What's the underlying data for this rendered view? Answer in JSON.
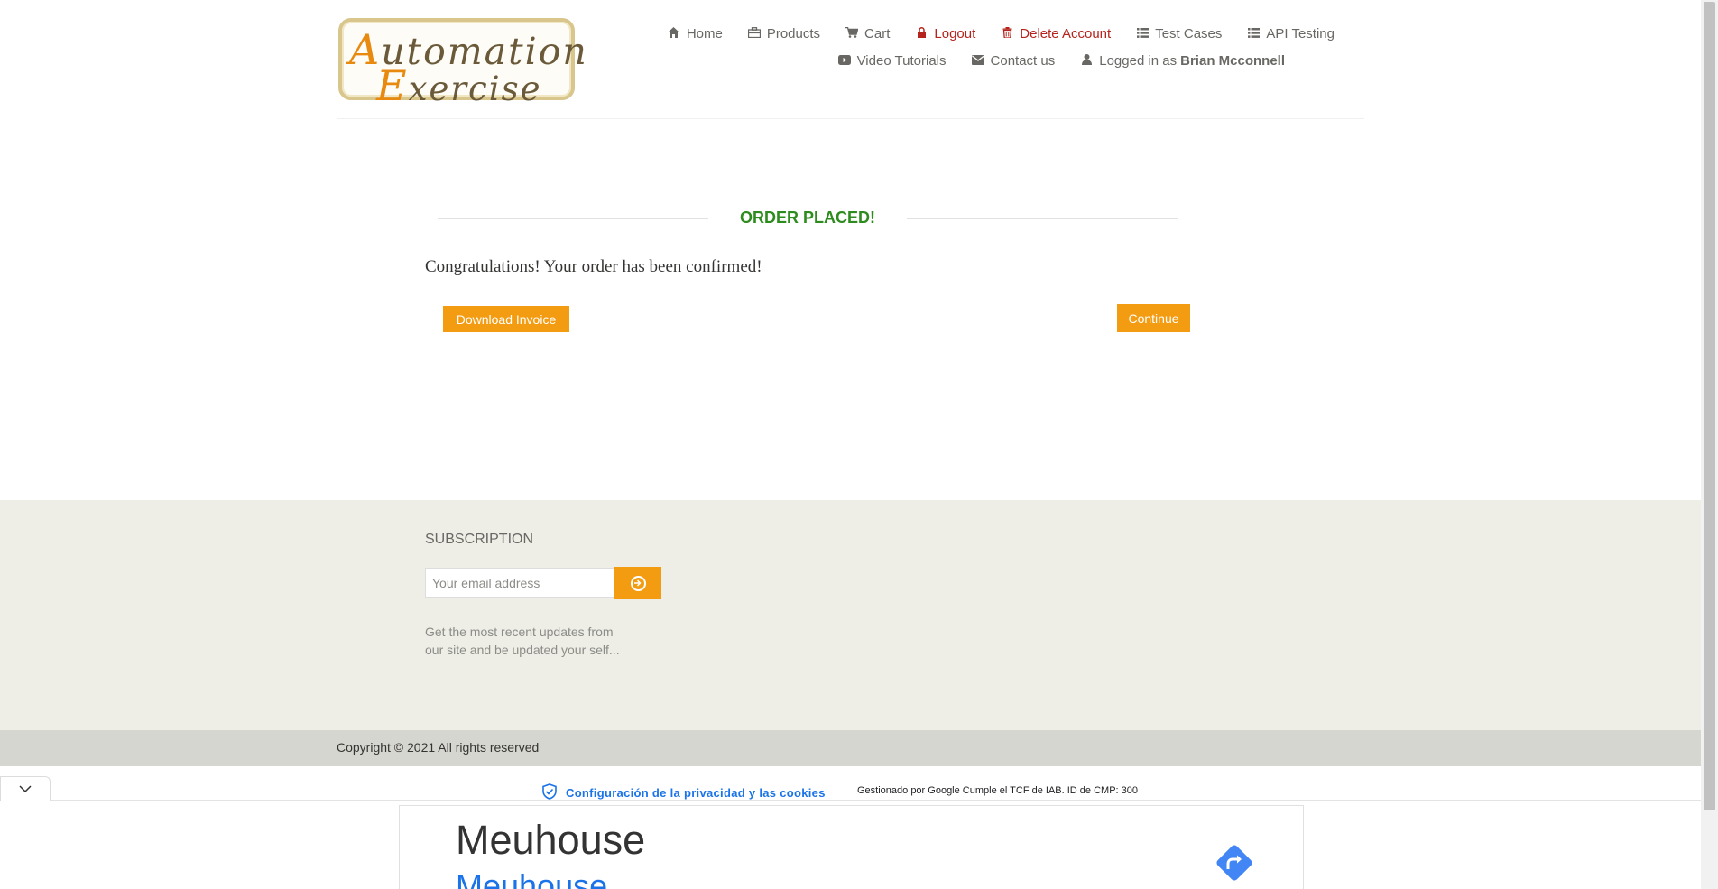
{
  "logo": {
    "line1_cap": "A",
    "line1_rest": "utomation",
    "line2_cap": "E",
    "line2_rest": "xercise"
  },
  "nav": {
    "row1": [
      {
        "icon": "home-icon",
        "label": "Home"
      },
      {
        "icon": "briefcase-icon",
        "label": "Products"
      },
      {
        "icon": "cart-icon",
        "label": "Cart"
      },
      {
        "icon": "lock-icon",
        "label": "Logout"
      },
      {
        "icon": "trash-icon",
        "label": "Delete Account"
      },
      {
        "icon": "list-icon",
        "label": "Test Cases"
      },
      {
        "icon": "list-icon",
        "label": "API Testing"
      }
    ],
    "row2": [
      {
        "icon": "video-icon",
        "label": "Video Tutorials"
      },
      {
        "icon": "envelope-icon",
        "label": "Contact us"
      },
      {
        "icon": "user-icon",
        "label": "Logged in as",
        "user": "Brian Mcconnell"
      }
    ]
  },
  "order": {
    "title": "ORDER PLACED!",
    "message": "Congratulations! Your order has been confirmed!",
    "download_label": "Download Invoice",
    "continue_label": "Continue"
  },
  "subscription": {
    "title": "SUBSCRIPTION",
    "placeholder": "Your email address",
    "description": "Get the most recent updates from our site and be updated your self..."
  },
  "footer": {
    "copyright": "Copyright © 2021 All rights reserved"
  },
  "privacy": {
    "link_label": "Configuración de la privacidad y las cookies",
    "note": "Gestionado por Google Cumple el TCF de IAB. ID de CMP: 300"
  },
  "ad": {
    "title": "Meuhouse",
    "subtitle": "Meuhouse"
  },
  "colors": {
    "accent": "#f39c12",
    "success": "#2e8b1e",
    "danger": "#b4241c",
    "link": "#1a73e8"
  }
}
